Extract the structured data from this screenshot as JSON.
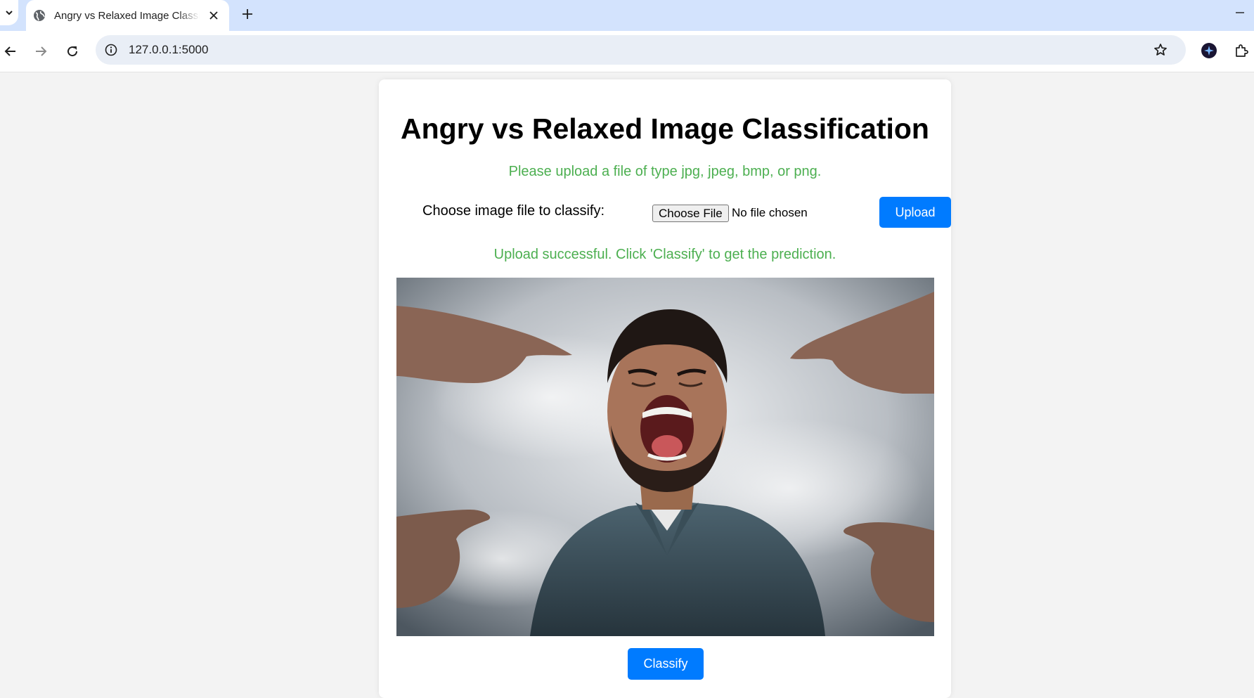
{
  "browser": {
    "tab_title": "Angry vs Relaxed Image Classification",
    "url": "127.0.0.1:5000"
  },
  "page": {
    "heading": "Angry vs Relaxed Image Classification",
    "file_types_hint": "Please upload a file of type jpg, jpeg, bmp, or png.",
    "form": {
      "label": "Choose image file to classify:",
      "choose_file_label": "Choose File",
      "no_file_text": "No file chosen",
      "upload_label": "Upload"
    },
    "status_message": "Upload successful. Click 'Classify' to get the prediction.",
    "preview_image": "angry man screaming with fingers pointing at him",
    "classify_label": "Classify"
  },
  "colors": {
    "accent_blue": "#007bff",
    "success_green": "#4caf50",
    "tabstrip": "#d3e3fd"
  }
}
